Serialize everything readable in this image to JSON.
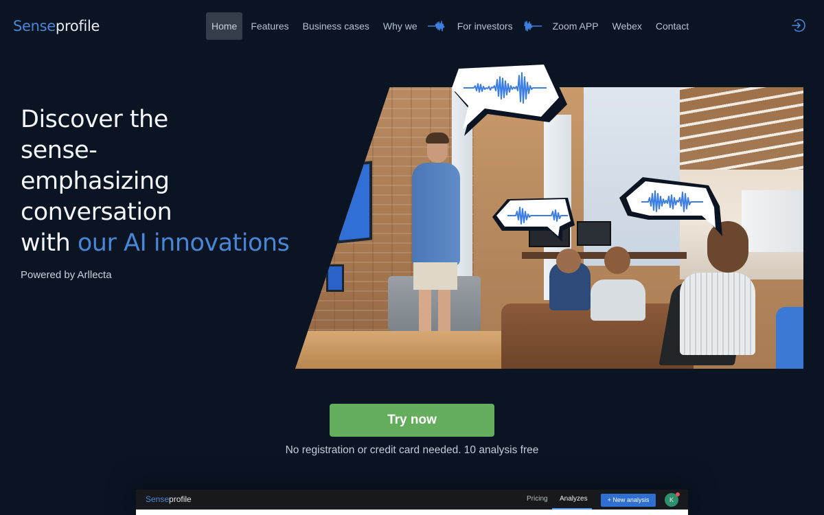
{
  "brand": {
    "name_part1": "Sense",
    "name_part2": "profile",
    "accent_color": "#4a86d8"
  },
  "nav": {
    "items": [
      {
        "label": "Home",
        "active": true
      },
      {
        "label": "Features"
      },
      {
        "label": "Business cases"
      },
      {
        "label": "Why we"
      },
      {
        "label": "For investors"
      },
      {
        "label": "Zoom APP"
      },
      {
        "label": "Webex"
      },
      {
        "label": "Contact"
      }
    ],
    "decorations": [
      "soundwave-icon",
      "soundwave-icon"
    ],
    "login_icon": "sign-in-icon"
  },
  "hero": {
    "title_line1": "Discover the",
    "title_line2": "sense-",
    "title_line3": "emphasizing",
    "title_line4": "conversation",
    "title_line5_plain": "with ",
    "title_line5_accent": "our AI innovations",
    "powered_by": "Powered by Arllecta",
    "image_alt": "Presenter speaking to a team in an office with speech bubbles showing sound waves"
  },
  "cta": {
    "button_label": "Try now",
    "button_color": "#63ad5c",
    "note": "No registration or credit card needed. 10 analysis free"
  },
  "app_preview": {
    "logo_part1": "Sense",
    "logo_part2": "profile",
    "links": [
      "Pricing",
      "Analyzes"
    ],
    "active_link": "Analyzes",
    "new_button": "+ New analysis",
    "avatar_initial": "K"
  }
}
